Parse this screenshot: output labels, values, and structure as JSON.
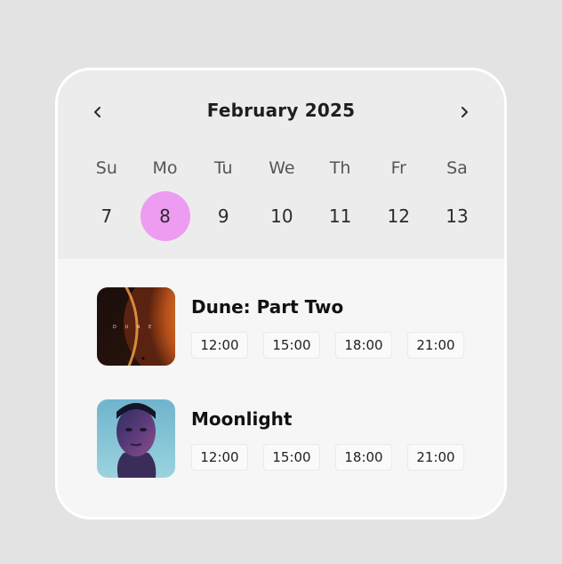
{
  "calendar": {
    "month_title": "February 2025",
    "weekdays": [
      "Su",
      "Mo",
      "Tu",
      "We",
      "Th",
      "Fr",
      "Sa"
    ],
    "dates": [
      "7",
      "8",
      "9",
      "10",
      "11",
      "12",
      "13"
    ],
    "selected_date": "8",
    "selected_color": "#ee9cf1"
  },
  "movies": [
    {
      "title": "Dune: Part Two",
      "times": [
        "12:00",
        "15:00",
        "18:00",
        "21:00"
      ]
    },
    {
      "title": "Moonlight",
      "times": [
        "12:00",
        "15:00",
        "18:00",
        "21:00"
      ]
    }
  ],
  "icons": {
    "prev": "chevron-left-icon",
    "next": "chevron-right-icon"
  }
}
